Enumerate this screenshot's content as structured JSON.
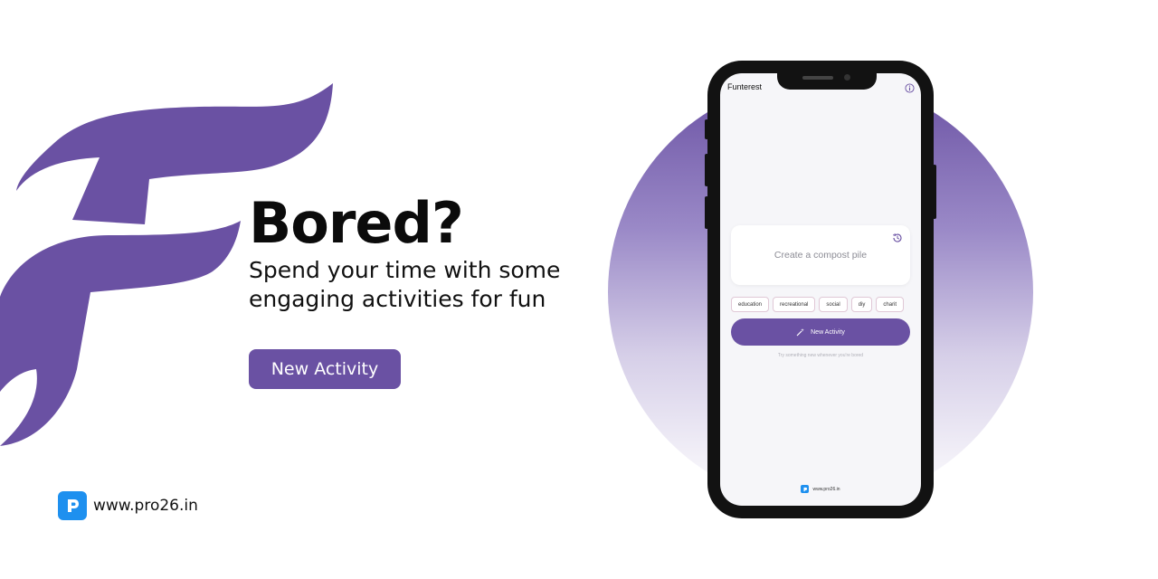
{
  "hero": {
    "headline": "Bored?",
    "subtext": "Spend your time with some engaging activities for fun",
    "cta_label": "New Activity"
  },
  "brand": {
    "url": "www.pro26.in",
    "logo_icon": "p-letter-badge-icon",
    "logo_color": "#1e90ef"
  },
  "colors": {
    "accent": "#6a51a3",
    "text": "#0b0b0b",
    "background": "#ffffff"
  },
  "phone": {
    "app_title": "Funterest",
    "info_icon": "info-icon",
    "card": {
      "activity": "Create a compost pile",
      "history_icon": "history-icon"
    },
    "chips": [
      "education",
      "recreational",
      "social",
      "diy",
      "charit"
    ],
    "button_label": "New Activity",
    "button_icon": "magic-wand-icon",
    "hint": "Try something new whenever you're bored",
    "footer_url": "www.pro26.in"
  }
}
